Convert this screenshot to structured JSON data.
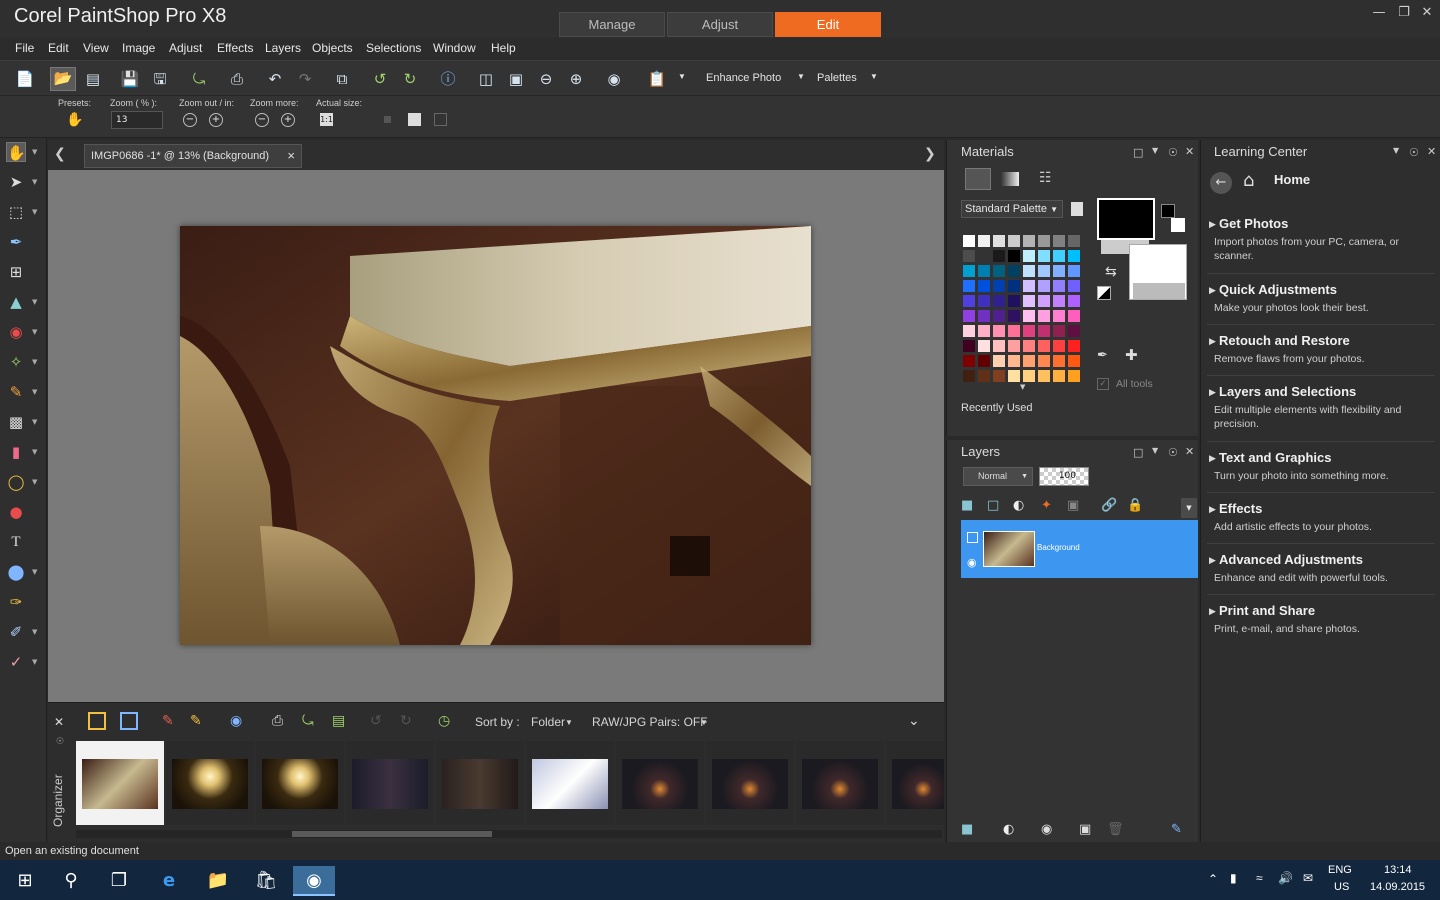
{
  "app": {
    "title": "Corel PaintShop Pro X8",
    "workspace_tabs": [
      {
        "label": "Manage",
        "active": false
      },
      {
        "label": "Adjust",
        "active": false
      },
      {
        "label": "Edit",
        "active": true
      }
    ],
    "accent_color": "#f06b22"
  },
  "menu": [
    "File",
    "Edit",
    "View",
    "Image",
    "Adjust",
    "Effects",
    "Layers",
    "Objects",
    "Selections",
    "Window",
    "Help"
  ],
  "toolbar": {
    "enhance_photo": "Enhance Photo",
    "palettes": "Palettes"
  },
  "tool_options": {
    "presets_label": "Presets:",
    "zoom_label": "Zoom ( % ):",
    "zoom_value": "13",
    "zoom_out_in_label": "Zoom out / in:",
    "zoom_more_label": "Zoom more:",
    "actual_size_label": "Actual size:"
  },
  "document": {
    "tab_title": "IMGP0686 -1* @  13% (Background)",
    "close": "×"
  },
  "organizer": {
    "label": "Organizer",
    "sort_by_label": "Sort by :",
    "sort_by_value": "Folder",
    "raw_jpg": "RAW/JPG Pairs: OFF",
    "thumbnails": [
      {
        "name": "table",
        "selected": true
      },
      {
        "name": "lamp-1",
        "selected": false
      },
      {
        "name": "lamp-2",
        "selected": false
      },
      {
        "name": "figures-1",
        "selected": false
      },
      {
        "name": "figures-2",
        "selected": false
      },
      {
        "name": "chandelier",
        "selected": false
      },
      {
        "name": "fireplace-1",
        "selected": false
      },
      {
        "name": "fireplace-2",
        "selected": false
      },
      {
        "name": "fireplace-3",
        "selected": false
      },
      {
        "name": "fireplace-4",
        "selected": false
      }
    ]
  },
  "materials": {
    "title": "Materials",
    "palette_select": "Standard Palette",
    "recently_used": "Recently Used",
    "all_tools": "All tools",
    "foreground_color": "#000000",
    "background_color": "#ffffff"
  },
  "layers": {
    "title": "Layers",
    "blend_mode": "Normal",
    "opacity": "100",
    "layer_name": "Background",
    "selected_color": "#3d96f0"
  },
  "learning_center": {
    "title": "Learning Center",
    "home": "Home",
    "sections": [
      {
        "heading": "Get Photos",
        "desc": "Import photos from your PC, camera, or scanner."
      },
      {
        "heading": "Quick Adjustments",
        "desc": "Make your photos look their best."
      },
      {
        "heading": "Retouch and Restore",
        "desc": "Remove flaws from your photos."
      },
      {
        "heading": "Layers and Selections",
        "desc": "Edit multiple elements with flexibility and precision."
      },
      {
        "heading": "Text and Graphics",
        "desc": "Turn your photo into something more."
      },
      {
        "heading": "Effects",
        "desc": "Add artistic effects to your photos."
      },
      {
        "heading": "Advanced Adjustments",
        "desc": "Enhance and edit with powerful tools."
      },
      {
        "heading": "Print and Share",
        "desc": "Print, e-mail, and share photos."
      }
    ]
  },
  "status": "Open an existing document",
  "taskbar": {
    "lang_top": "ENG",
    "lang_bottom": "US",
    "time": "13:14",
    "date": "14.09.2015"
  }
}
